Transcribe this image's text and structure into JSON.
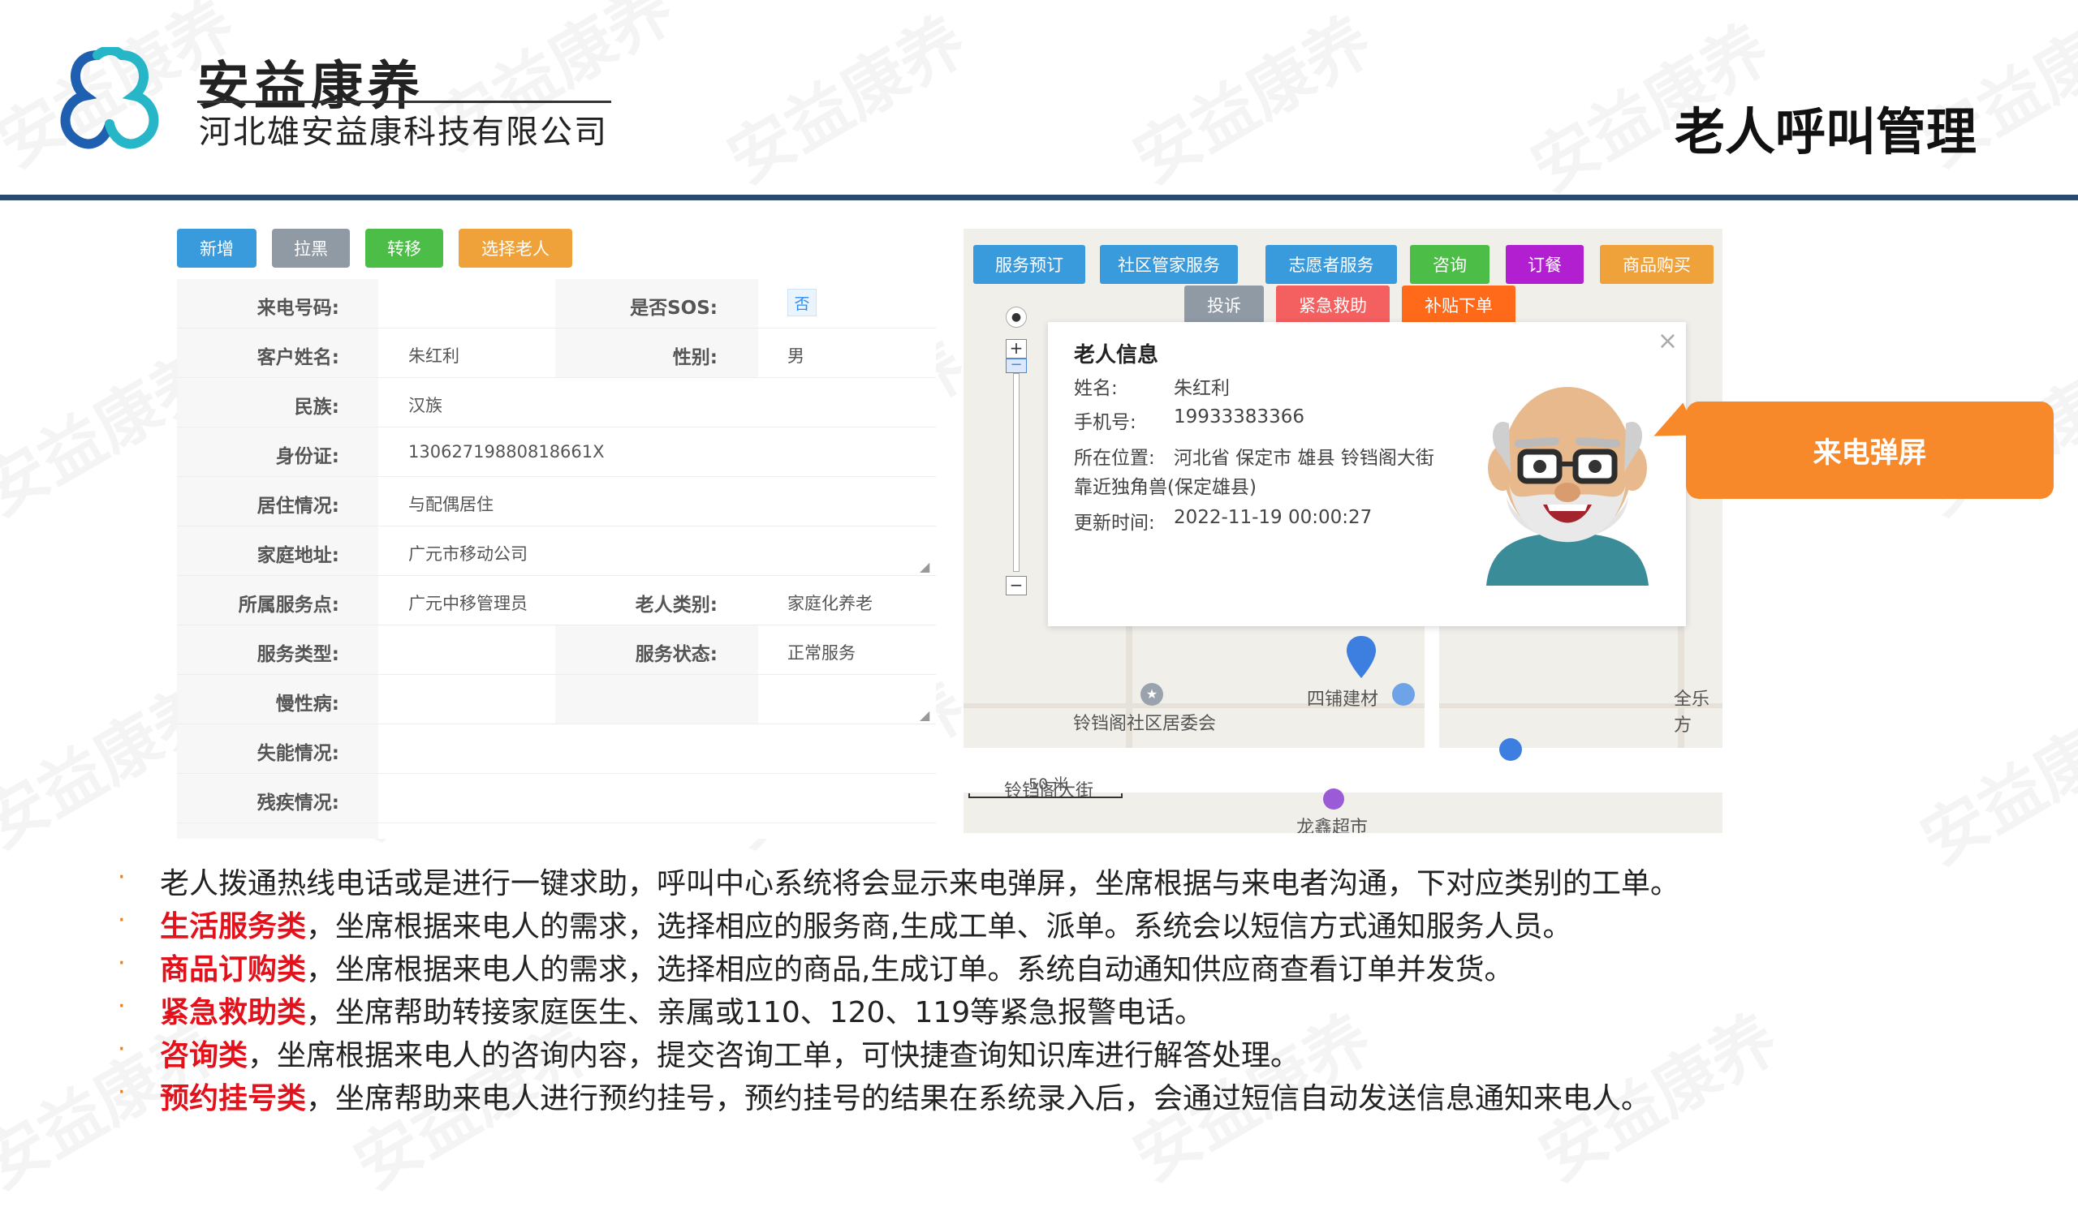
{
  "header": {
    "brand": "安益康养",
    "company": "河北雄安益康科技有限公司",
    "page_title": "老人呼叫管理"
  },
  "watermark": "安益康养",
  "toolbar": {
    "add": "新增",
    "blacklist": "拉黑",
    "transfer": "转移",
    "select_elder": "选择老人"
  },
  "form": {
    "phone_label": "来电号码:",
    "phone_value": "",
    "sos_label": "是否SOS:",
    "sos_value": "否",
    "name_label": "客户姓名:",
    "name_value": "朱红利",
    "gender_label": "性别:",
    "gender_value": "男",
    "ethnicity_label": "民族:",
    "ethnicity_value": "汉族",
    "id_label": "身份证:",
    "id_value": "13062719880818661X",
    "living_label": "居住情况:",
    "living_value": "与配偶居住",
    "address_label": "家庭地址:",
    "address_value": "广元市移动公司",
    "service_point_label": "所属服务点:",
    "service_point_value": "广元中移管理员",
    "elder_type_label": "老人类别:",
    "elder_type_value": "家庭化养老",
    "service_type_label": "服务类型:",
    "service_type_value": "",
    "service_status_label": "服务状态:",
    "service_status_value": "正常服务",
    "chronic_label": "慢性病:",
    "disability_label": "失能情况:",
    "handicap_label": "残疾情况:"
  },
  "map_buttons": {
    "appointment": "服务预订",
    "community": "社区管家服务",
    "volunteer": "志愿者服务",
    "consult": "咨询",
    "meal": "订餐",
    "goods": "商品购买",
    "complaint": "投诉",
    "emergency": "紧急救助",
    "subsidy": "补贴下单"
  },
  "popup": {
    "title": "老人信息",
    "name_key": "姓名:",
    "name_val": "朱红利",
    "phone_key": "手机号:",
    "phone_val": "19933383366",
    "loc_key": "所在位置:",
    "loc_val": "河北省 保定市 雄县 铃铛阁大街",
    "loc_val2": "靠近独角兽(保定雄县)",
    "time_key": "更新时间:",
    "time_val": "2022-11-19 00:00:27"
  },
  "map_labels": {
    "committee": "铃铛阁社区居委会",
    "store": "四铺建材",
    "quanyuan": "全乐方",
    "street": "铃铛阁大街",
    "scale": "50 米",
    "market": "龙鑫超市"
  },
  "callout": "来电弹屏",
  "bullets": [
    {
      "hl": "",
      "text": "老人拨通热线电话或是进行一键求助，呼叫中心系统将会显示来电弹屏，坐席根据与来电者沟通，下对应类别的工单。"
    },
    {
      "hl": "生活服务类",
      "text": "，坐席根据来电人的需求，选择相应的服务商,生成工单、派单。系统会以短信方式通知服务人员。"
    },
    {
      "hl": "商品订购类",
      "text": "，坐席根据来电人的需求，选择相应的商品,生成订单。系统自动通知供应商查看订单并发货。"
    },
    {
      "hl": "紧急救助类",
      "text": "，坐席帮助转接家庭医生、亲属或110、120、119等紧急报警电话。"
    },
    {
      "hl": "咨询类",
      "text": "，坐席根据来电人的咨询内容，提交咨询工单，可快捷查询知识库进行解答处理。"
    },
    {
      "hl": "预约挂号类",
      "text": "，坐席帮助来电人进行预约挂号，预约挂号的结果在系统录入后，会通过短信自动发送信息通知来电人。"
    }
  ],
  "bullet_symbol": "·",
  "colors": {
    "header_rule": "#2b4a6f",
    "btn_blue": "#3a9bdc",
    "btn_gray": "#8f9aa5",
    "btn_green": "#4cbd47",
    "btn_orange": "#f0a23a",
    "btn_purple": "#b21fd1",
    "btn_red": "#f45f5f",
    "btn_orange_red": "#ff6a1a",
    "callout": "#f7892b",
    "highlight": "#e3111b"
  }
}
